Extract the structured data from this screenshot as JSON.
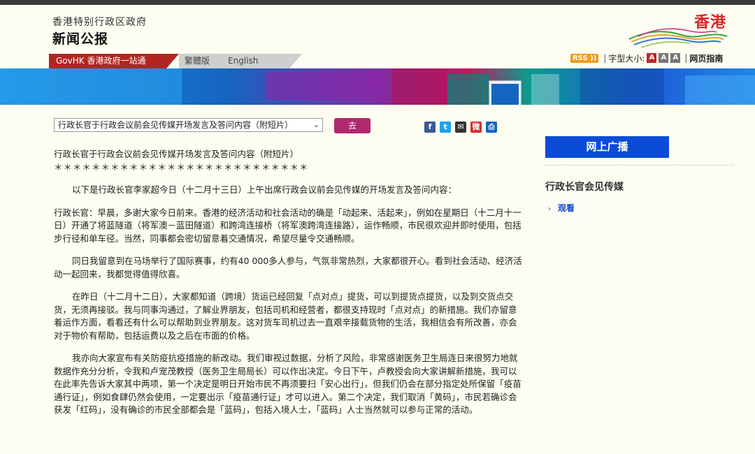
{
  "header": {
    "org_name": "香港特别行政区政府",
    "site_title": "新闻公报",
    "logo_text": "香港"
  },
  "nav": {
    "govhk": "GovHK 香港政府一站通",
    "traditional": "繁體版",
    "english": "English"
  },
  "utility": {
    "rss": "RSS",
    "font_size_label": "字型大小:",
    "font_sizes": [
      "A",
      "A",
      "A"
    ],
    "web_guide": "网页指南"
  },
  "selector": {
    "selected": "行政长官于行政会议前会见传媒开场发言及答问内容（附短片）",
    "go_label": "去"
  },
  "share_icons": [
    "facebook-icon",
    "twitter-icon",
    "email-icon",
    "weibo-icon",
    "print-icon"
  ],
  "article": {
    "headline": "行政长官于行政会议前会见传媒开场发言及答问内容（附短片）",
    "stars": "＊＊＊＊＊＊＊＊＊＊＊＊＊＊＊＊＊＊＊＊＊＊＊＊＊＊＊",
    "intro": "以下是行政长官李家超今日（十二月十三日）上午出席行政会议前会见传媒的开场发言及答问内容：",
    "paragraphs": [
      "行政长官：早晨，多谢大家今日前来。香港的经济活动和社会活动的确是「动起来、活起来」，例如在星期日（十二月十一日）开通了将蓝隧道（将军澳－蓝田隧道）和跨湾连接桥（将军澳跨湾连接路），运作畅顺，市民很欢迎并即时使用，包括步行径和单车径。当然，同事都会密切留意着交通情况，希望尽量令交通畅顺。",
      "同日我留意到在马场举行了国际赛事，约有40 000多人参与，气氛非常热烈，大家都很开心。看到社会活动、经济活动一起回来，我都觉得值得欣喜。",
      "在昨日（十二月十二日），大家都知道（跨境）货运已经回复「点对点」提货，可以到提货点提货，以及到交货点交货，无须再接驳。我与同事沟通过，了解业界朋友，包括司机和经营者，都很支持现时「点对点」的新措施。我们亦留意着运作方面，看看还有什么可以帮助到业界朋友。这对货车司机过去一直艰辛接载货物的生活，我相信会有所改善，亦会对于物价有帮助，包括运费以及之后在市面的价格。",
      "我亦向大家宣布有关防疫抗疫措施的新改动。我们审视过数据，分析了风险，非常感谢医务卫生局连日来很努力地就数据作充分分析，令我和卢宠茂教授（医务卫生局局长）可以作出决定。今日下午，卢教授会向大家讲解新措施，我可以在此率先告诉大家其中两项，第一个决定是明日开始市民不再须要扫「安心出行」，但我们仍会在部分指定处所保留「疫苗通行证」，例如食肆仍然会使用，一定要出示「疫苗通行证」才可以进入。第二个决定，我们取消「黄码」，市民若确诊会获发「红码」，没有确诊的市民全部都会是「蓝码」，包括入境人士，「蓝码」人士当然就可以参与正常的活动。"
    ]
  },
  "sidebar": {
    "webcast_label": "网上广播",
    "section_title": "行政长官会见传媒",
    "watch_link": "观看"
  }
}
